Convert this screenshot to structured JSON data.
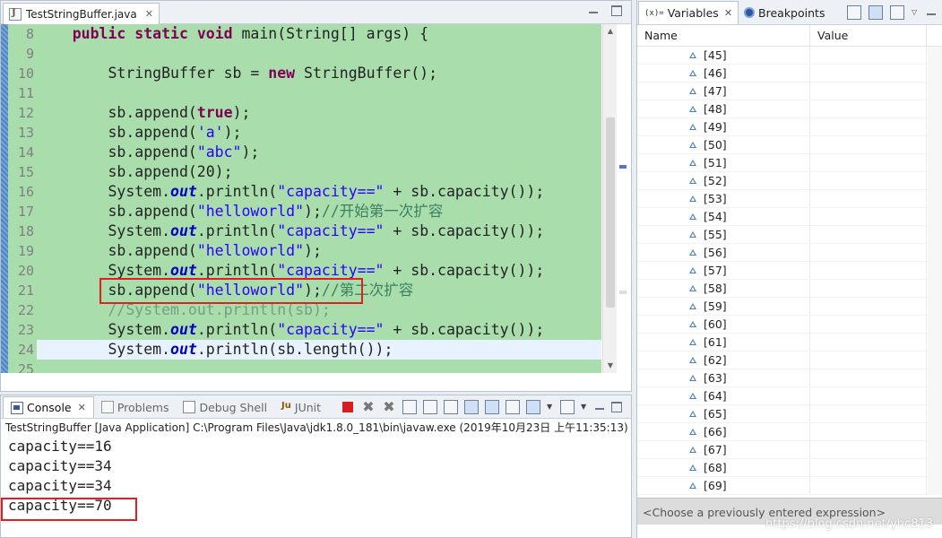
{
  "editor": {
    "tab_title": "TestStringBuffer.java",
    "close_label": "✕",
    "lines": [
      {
        "num": "8",
        "html": "    <span class=\"kw\">public static void</span> main(String[] args) {"
      },
      {
        "num": "9",
        "html": ""
      },
      {
        "num": "10",
        "html": "        StringBuffer sb = <span class=\"kw\">new</span> StringBuffer();"
      },
      {
        "num": "11",
        "html": ""
      },
      {
        "num": "12",
        "html": "        sb.append(<span class=\"kw\">true</span>);"
      },
      {
        "num": "13",
        "html": "        sb.append(<span class=\"str\">'a'</span>);"
      },
      {
        "num": "14",
        "html": "        sb.append(<span class=\"str\">\"abc\"</span>);"
      },
      {
        "num": "15",
        "html": "        sb.append(20);"
      },
      {
        "num": "16",
        "html": "        System.<span class=\"fld\">out</span>.println(<span class=\"str\">\"capacity==\"</span> + sb.capacity());"
      },
      {
        "num": "17",
        "html": "        sb.append(<span class=\"str\">\"helloworld\"</span>);<span class=\"cmt\">//开始第一次扩容</span>"
      },
      {
        "num": "18",
        "html": "        System.<span class=\"fld\">out</span>.println(<span class=\"str\">\"capacity==\"</span> + sb.capacity());"
      },
      {
        "num": "19",
        "html": "        sb.append(<span class=\"str\">\"helloworld\"</span>);"
      },
      {
        "num": "20",
        "html": "        System.<span class=\"fld\">out</span>.println(<span class=\"str\">\"capacity==\"</span> + sb.capacity());"
      },
      {
        "num": "21",
        "html": "        sb.append(<span class=\"str\">\"helloworld\"</span>);<span class=\"cmt\">//第二次扩容</span>"
      },
      {
        "num": "22",
        "html": "        <span class=\"cmt-dis\">//System.out.println(sb);</span>"
      },
      {
        "num": "23",
        "html": "        System.<span class=\"fld\">out</span>.println(<span class=\"str\">\"capacity==\"</span> + sb.capacity());"
      },
      {
        "num": "24",
        "html": "        System.<span class=\"fld\">out</span>.println(sb.length());",
        "current": true
      },
      {
        "num": "25",
        "html": ""
      }
    ]
  },
  "console": {
    "tabs": [
      {
        "label": "Console",
        "icon": "console-icon",
        "active": true
      },
      {
        "label": "Problems",
        "icon": "problems-icon"
      },
      {
        "label": "Debug Shell",
        "icon": "debug-shell-icon"
      },
      {
        "label": "JUnit",
        "icon": "junit-icon",
        "prefix": "Ju"
      }
    ],
    "launch_label": "TestStringBuffer [Java Application] C:\\Program Files\\Java\\jdk1.8.0_181\\bin\\javaw.exe (2019年10月23日 上午11:35:13)",
    "output": [
      "capacity==16",
      "capacity==34",
      "capacity==34",
      "capacity==70"
    ]
  },
  "variables": {
    "tabs": [
      {
        "label": "Variables",
        "icon": "variables-icon",
        "prefix": "(x)=",
        "active": true
      },
      {
        "label": "Breakpoints",
        "icon": "breakpoints-icon"
      }
    ],
    "columns": {
      "name": "Name",
      "value": "Value"
    },
    "rows": [
      "[45]",
      "[46]",
      "[47]",
      "[48]",
      "[49]",
      "[50]",
      "[51]",
      "[52]",
      "[53]",
      "[54]",
      "[55]",
      "[56]",
      "[57]",
      "[58]",
      "[59]",
      "[60]",
      "[61]",
      "[62]",
      "[63]",
      "[64]",
      "[65]",
      "[66]",
      "[67]",
      "[68]",
      "[69]"
    ],
    "expression_placeholder": "<Choose a previously entered expression>",
    "watermark": "https://blog.csdn.net/yhc813"
  },
  "colors": {
    "editor_background": "#a9deac",
    "highlight_box": "#e02020",
    "keyword": "#7f0055",
    "string": "#2a00ff"
  }
}
